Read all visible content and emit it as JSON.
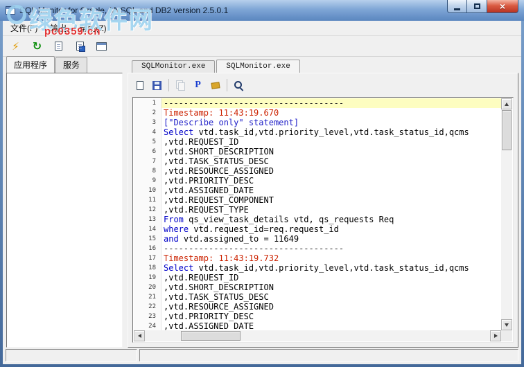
{
  "window": {
    "title": "SQL Monitor for Oracle, MySQL and DB2 version 2.5.0.1"
  },
  "watermark": {
    "text": "绿色软件网",
    "site": "pc0359.cn"
  },
  "menu": {
    "items": [
      "文件(F)",
      "输出",
      "帮助(Z)"
    ]
  },
  "main_toolbar": {
    "buttons": [
      {
        "name": "start-monitor-button",
        "icon": "lightning-icon",
        "glyph": "⚡"
      },
      {
        "name": "refresh-button",
        "icon": "refresh-icon",
        "glyph": "↻"
      },
      {
        "name": "open-log-button",
        "icon": "document-icon"
      },
      {
        "name": "export-log-button",
        "icon": "document-save-icon"
      },
      {
        "name": "window-button",
        "icon": "window-icon"
      }
    ]
  },
  "left_panel": {
    "tabs": [
      {
        "label": "应用程序",
        "active": true
      },
      {
        "label": "服务",
        "active": false
      }
    ],
    "items": []
  },
  "session_tabs": [
    {
      "label": "SQLMonitor.exe",
      "active": false
    },
    {
      "label": "SQLMonitor.exe",
      "active": true
    }
  ],
  "editor_toolbar": [
    {
      "name": "new-button",
      "icon": "new-page-icon"
    },
    {
      "name": "save-button",
      "icon": "save-icon"
    },
    {
      "separator": true
    },
    {
      "name": "copy-button",
      "icon": "copy-icon",
      "disabled": true
    },
    {
      "name": "pause-button",
      "icon": "p-icon",
      "glyph": "P"
    },
    {
      "name": "clear-button",
      "icon": "clear-icon"
    },
    {
      "separator": true
    },
    {
      "name": "find-button",
      "icon": "magnifier-icon"
    }
  ],
  "status_bar": {
    "left": "",
    "right": ""
  },
  "colors": {
    "keyword": "#0000c8",
    "timestamp": "#cc2200",
    "plain": "#000000",
    "separator": "#2a2a2a",
    "describe": "#2020c8",
    "highlight": "#fdfdc0",
    "accent_red": "#e23333",
    "watermark_blue": "#9ed2ef"
  },
  "editor": {
    "lines": [
      {
        "num": "1",
        "highlight": true,
        "segs": [
          {
            "t": "------------------------------------",
            "c": "separator"
          }
        ]
      },
      {
        "num": "2",
        "segs": [
          {
            "t": "Timestamp: 11:43:19.670",
            "c": "timestamp"
          }
        ]
      },
      {
        "num": "3",
        "segs": [
          {
            "t": "[\"Describe only\" statement]",
            "c": "describe"
          }
        ]
      },
      {
        "num": "4",
        "segs": [
          {
            "t": "Select",
            "c": "keyword"
          },
          {
            "t": " vtd.task_id,vtd.priority_level,vtd.task_status_id,qcms",
            "c": "plain"
          }
        ]
      },
      {
        "num": "5",
        "segs": [
          {
            "t": ",vtd.REQUEST_ID",
            "c": "plain"
          }
        ]
      },
      {
        "num": "6",
        "segs": [
          {
            "t": ",vtd.SHORT_DESCRIPTION",
            "c": "plain"
          }
        ]
      },
      {
        "num": "7",
        "segs": [
          {
            "t": ",vtd.TASK_STATUS_DESC",
            "c": "plain"
          }
        ]
      },
      {
        "num": "8",
        "segs": [
          {
            "t": ",vtd.RESOURCE_ASSIGNED",
            "c": "plain"
          }
        ]
      },
      {
        "num": "9",
        "segs": [
          {
            "t": ",vtd.PRIORITY_DESC",
            "c": "plain"
          }
        ]
      },
      {
        "num": "10",
        "segs": [
          {
            "t": ",vtd.ASSIGNED_DATE",
            "c": "plain"
          }
        ]
      },
      {
        "num": "11",
        "segs": [
          {
            "t": ",vtd.REQUEST_COMPONENT",
            "c": "plain"
          }
        ]
      },
      {
        "num": "12",
        "segs": [
          {
            "t": ",vtd.REQUEST_TYPE",
            "c": "plain"
          }
        ]
      },
      {
        "num": "13",
        "segs": [
          {
            "t": "From",
            "c": "keyword"
          },
          {
            "t": " qs_view_task_details vtd, qs_requests Req",
            "c": "plain"
          }
        ]
      },
      {
        "num": "14",
        "segs": [
          {
            "t": "where",
            "c": "keyword"
          },
          {
            "t": " vtd.request_id=req.request_id",
            "c": "plain"
          }
        ]
      },
      {
        "num": "15",
        "segs": [
          {
            "t": "and",
            "c": "keyword"
          },
          {
            "t": " vtd.assigned_to = 11649",
            "c": "plain"
          }
        ]
      },
      {
        "num": "16",
        "segs": [
          {
            "t": "------------------------------------",
            "c": "separator"
          }
        ]
      },
      {
        "num": "17",
        "segs": [
          {
            "t": "Timestamp: 11:43:19.732",
            "c": "timestamp"
          }
        ]
      },
      {
        "num": "18",
        "segs": [
          {
            "t": "Select",
            "c": "keyword"
          },
          {
            "t": " vtd.task_id,vtd.priority_level,vtd.task_status_id,qcms",
            "c": "plain"
          }
        ]
      },
      {
        "num": "19",
        "segs": [
          {
            "t": ",vtd.REQUEST_ID",
            "c": "plain"
          }
        ]
      },
      {
        "num": "20",
        "segs": [
          {
            "t": ",vtd.SHORT_DESCRIPTION",
            "c": "plain"
          }
        ]
      },
      {
        "num": "21",
        "segs": [
          {
            "t": ",vtd.TASK_STATUS_DESC",
            "c": "plain"
          }
        ]
      },
      {
        "num": "22",
        "segs": [
          {
            "t": ",vtd.RESOURCE_ASSIGNED",
            "c": "plain"
          }
        ]
      },
      {
        "num": "23",
        "segs": [
          {
            "t": ",vtd.PRIORITY_DESC",
            "c": "plain"
          }
        ]
      },
      {
        "num": "24",
        "segs": [
          {
            "t": ",vtd.ASSIGNED_DATE",
            "c": "plain"
          }
        ]
      }
    ]
  }
}
